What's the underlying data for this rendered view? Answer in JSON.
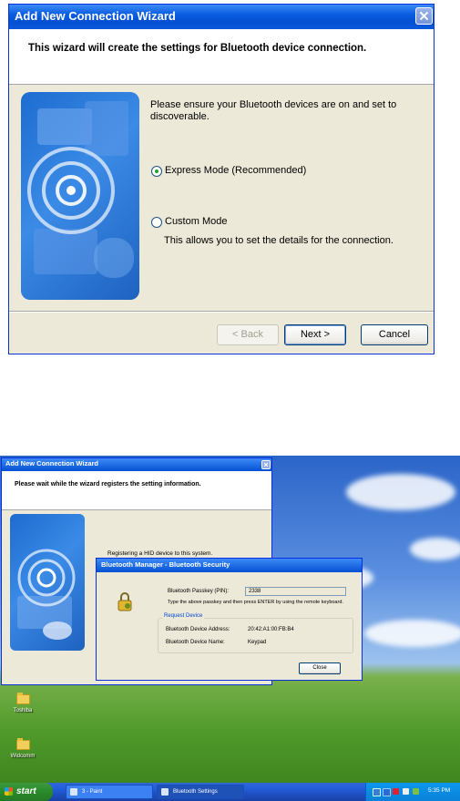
{
  "wizard1": {
    "title": "Add New Connection Wizard",
    "header": "This wizard will create the settings for Bluetooth device connection.",
    "intro": "Please ensure your Bluetooth devices are on and set to discoverable.",
    "options": [
      {
        "label": "Express Mode (Recommended)",
        "selected": true
      },
      {
        "label": "Custom Mode",
        "selected": false,
        "description": "This allows you to set the details for the connection."
      }
    ],
    "buttons": {
      "back": "< Back",
      "next": "Next >",
      "cancel": "Cancel"
    }
  },
  "wizard2": {
    "title": "Add New Connection Wizard",
    "header": "Please wait while the wizard registers the setting information.",
    "status": "Registering a HID device to this system."
  },
  "bt_dialog": {
    "title": "Bluetooth Manager - Bluetooth Security",
    "passkey_label": "Bluetooth Passkey (PIN):",
    "passkey_value": "2338",
    "instruction": "Type the above passkey and then press ENTER by using the remote keyboard.",
    "group_label": "Request Device",
    "address_label": "Bluetooth Device Address:",
    "address_value": "20:42:A1:00:FB:B4",
    "name_label": "Bluetooth Device Name:",
    "name_value": "Keypad",
    "close": "Close"
  },
  "desktop": {
    "icons": [
      {
        "label": "Toshiba"
      },
      {
        "label": "Widcomm"
      }
    ]
  },
  "taskbar": {
    "start": "start",
    "tasks": [
      {
        "label": "3 - Paint"
      },
      {
        "label": "Bluetooth Settings"
      }
    ],
    "clock": "5:35 PM"
  },
  "colors": {
    "title_blue": "#0a5de0",
    "dialog_bg": "#ece9d8",
    "start_green": "#2a8a2a",
    "tray_blue": "#0b81d8"
  }
}
